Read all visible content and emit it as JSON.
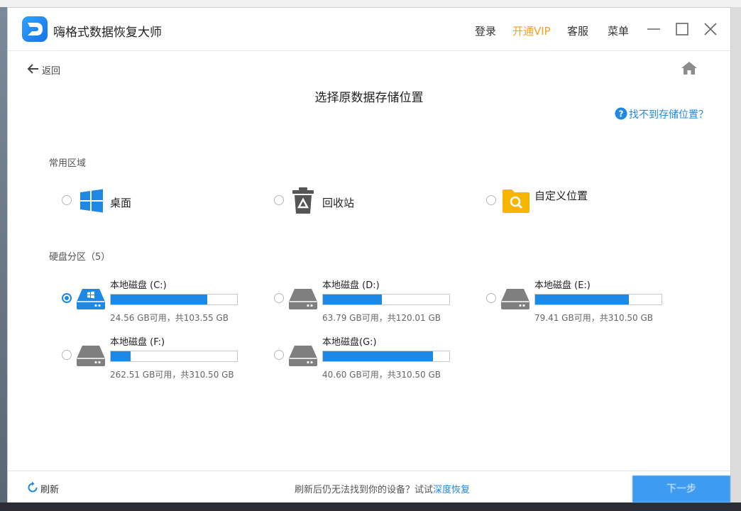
{
  "window": {
    "app_title": "嗨格式数据恢复大师",
    "links": {
      "login": "登录",
      "vip": "开通VIP",
      "service": "客服",
      "menu": "菜单"
    }
  },
  "nav": {
    "back_label": "返回"
  },
  "page": {
    "title": "选择原数据存储位置",
    "help_link": "找不到存储位置？"
  },
  "common": {
    "label": "常用区域",
    "items": [
      {
        "label": "桌面",
        "icon": "windows-icon"
      },
      {
        "label": "回收站",
        "icon": "recycle-bin-icon"
      },
      {
        "label": "自定义位置",
        "icon": "folder-search-icon"
      }
    ]
  },
  "drives": {
    "label": "硬盘分区（5）",
    "selected_index": 0,
    "items": [
      {
        "name": "本地磁盘 (C:)",
        "info": "24.56 GB可用，共103.55 GB",
        "used_fraction": 0.763
      },
      {
        "name": "本地磁盘 (D:)",
        "info": "63.79 GB可用，共120.01 GB",
        "used_fraction": 0.468
      },
      {
        "name": "本地磁盘 (E:)",
        "info": "79.41 GB可用，共310.50 GB",
        "used_fraction": 0.744
      },
      {
        "name": "本地磁盘 (F:)",
        "info": "262.51 GB可用，共310.50 GB",
        "used_fraction": 0.155
      },
      {
        "name": "本地磁盘(G:)",
        "info": "40.60 GB可用，共310.50 GB",
        "used_fraction": 0.869
      }
    ]
  },
  "footer": {
    "refresh_label": "刷新",
    "message": "刷新后仍无法找到你的设备？试试",
    "deep_link": "深度恢复",
    "next_label": "下一步"
  },
  "colors": {
    "accent": "#1e88e5",
    "vip": "#f5a11d",
    "folder": "#f7b500"
  }
}
